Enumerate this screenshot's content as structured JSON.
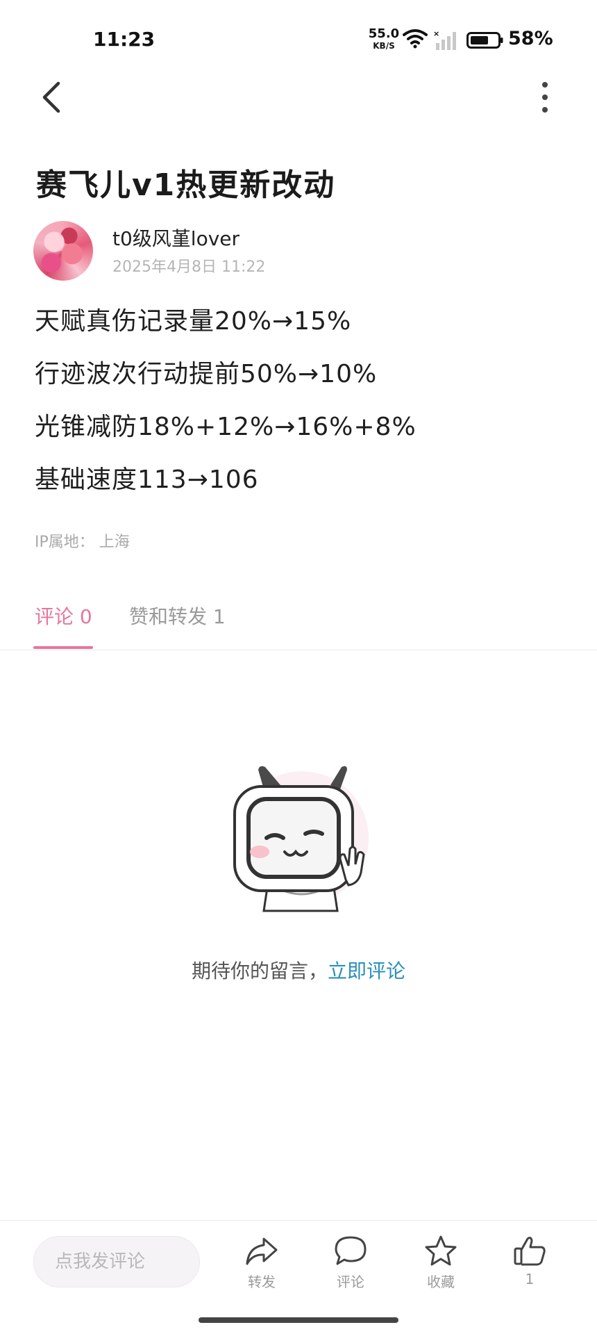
{
  "status_bar": {
    "time": "11:23",
    "net_speed_value": "55.0",
    "net_speed_unit": "KB/S",
    "battery_percent": "58%"
  },
  "post": {
    "title": "赛飞儿v1热更新改动",
    "author_name": "t0级风堇lover",
    "date": "2025年4月8日 11:22",
    "lines": [
      "天赋真伤记录量20%→15%",
      "行迹波次行动提前50%→10%",
      "光锥减防18%+12%→16%+8%",
      "基础速度113→106"
    ],
    "ip_location": "IP属地： 上海"
  },
  "tabs": {
    "comments": "评论 0",
    "likes_reposts": "赞和转发 1"
  },
  "empty_state": {
    "hint": "期待你的留言，",
    "link": "立即评论"
  },
  "bottom_bar": {
    "input_placeholder": "点我发评论",
    "share_label": "转发",
    "comment_label": "评论",
    "favorite_label": "收藏",
    "like_count": "1"
  },
  "colors": {
    "accent_pink": "#e8759c",
    "link_blue": "#2a8fb8"
  }
}
